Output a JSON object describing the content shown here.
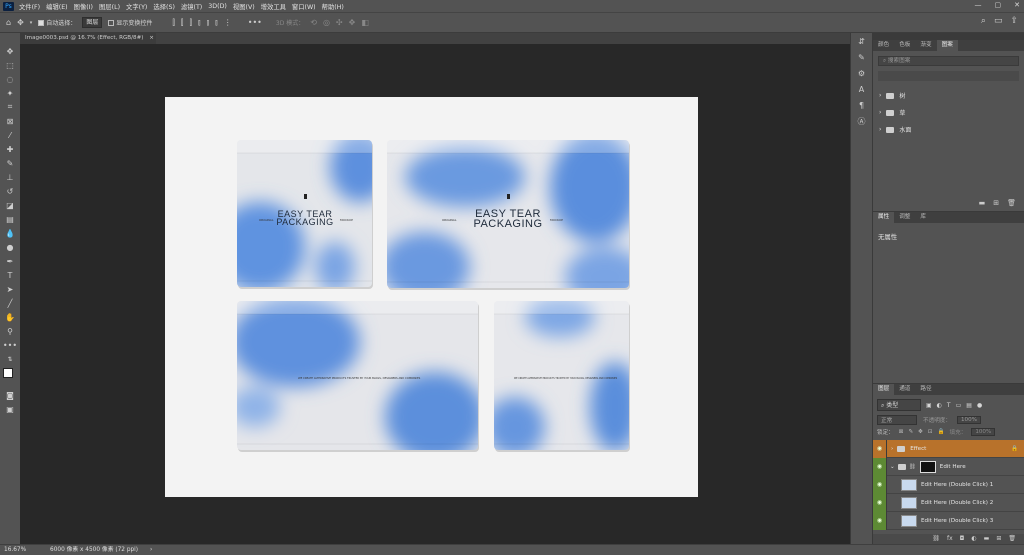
{
  "app": {
    "logo": "Ps"
  },
  "menu": [
    "文件(F)",
    "编辑(E)",
    "图像(I)",
    "图层(L)",
    "文字(Y)",
    "选择(S)",
    "滤镜(T)",
    "3D(D)",
    "视图(V)",
    "增效工具",
    "窗口(W)",
    "帮助(H)"
  ],
  "options": {
    "auto_select_label": "自动选择：",
    "auto_select_value": "图层",
    "transform_label": "显示变换控件",
    "mode_label": "3D 模式："
  },
  "doc_tab": {
    "title": "Image0003.psd @ 16.7% (Effect, RGB/8#)",
    "close": "×"
  },
  "mockup": {
    "brand_line1": "EASY TEAR",
    "brand_line2": "PACKAGING",
    "side_left": "ORIGINAL",
    "side_right": "MOCKUP",
    "fine_print": "WE CREATE ALTERNATIVE PRODUCTS TRUSTED BY YOUR BLOGS, DESIGNERS AND COMPANIES"
  },
  "status": {
    "zoom": "16.67%",
    "size": "6000 像素 x 4500 像素 (72 ppi)"
  },
  "libraries_panel": {
    "tabs": [
      "颜色",
      "色板",
      "渐变",
      "图案"
    ],
    "active_tab": "图案",
    "search_placeholder": "搜索图案",
    "folders": [
      "树",
      "草",
      "水面"
    ]
  },
  "properties_panel": {
    "tabs": [
      "属性",
      "调整",
      "库"
    ],
    "active_tab": "属性",
    "empty_text": "无属性"
  },
  "layers_panel": {
    "tabs": [
      "图层",
      "通道",
      "路径"
    ],
    "active_tab": "图层",
    "filter_kind": "类型",
    "blend_mode": "正常",
    "opacity_label": "不透明度：",
    "opacity_value": "100%",
    "lock_label": "锁定：",
    "fill_label": "填充：",
    "fill_value": "100%",
    "layers": [
      {
        "name": "Effect",
        "type": "group"
      },
      {
        "name": "Edit Here",
        "type": "smart"
      },
      {
        "name": "Edit Here (Double Click) 1",
        "type": "smart"
      },
      {
        "name": "Edit Here (Double Click) 2",
        "type": "smart"
      },
      {
        "name": "Edit Here (Double Click) 3",
        "type": "smart"
      }
    ]
  },
  "colors": {
    "accent_blue": "#5b8fd9",
    "layer_eye_green": "#5d8a34",
    "group_orange": "#b8722b"
  }
}
